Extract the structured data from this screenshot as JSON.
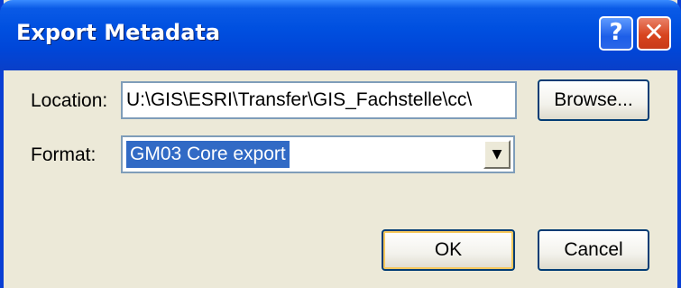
{
  "window": {
    "title": "Export Metadata",
    "help_symbol": "?",
    "close_symbol": "✕"
  },
  "form": {
    "location_label": "Location:",
    "location_value": "U:\\GIS\\ESRI\\Transfer\\GIS_Fachstelle\\cc\\",
    "format_label": "Format:",
    "format_value": "GM03 Core export"
  },
  "buttons": {
    "browse": "Browse...",
    "ok": "OK",
    "cancel": "Cancel"
  },
  "icons": {
    "dropdown": "chevron-down-icon"
  },
  "colors": {
    "titlebar": "#0050e0",
    "dialog_bg": "#ece9d8",
    "selection": "#316ac5",
    "close_button": "#d8451f"
  }
}
